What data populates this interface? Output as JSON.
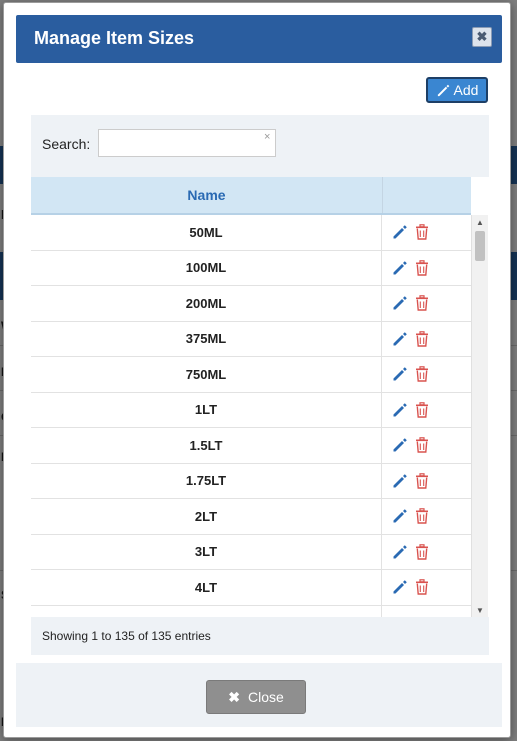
{
  "modal": {
    "title": "Manage Item Sizes",
    "header_close_glyph": "✖",
    "add_label": "Add",
    "search_label": "Search:",
    "search_value": "",
    "search_clear_glyph": "×",
    "column_name": "Name",
    "rows": [
      "50ML",
      "100ML",
      "200ML",
      "375ML",
      "750ML",
      "1LT",
      "1.5LT",
      "1.75LT",
      "2LT",
      "3LT",
      "4LT",
      ""
    ],
    "info": "Showing 1 to 135 of 135 entries",
    "close_label": "Close",
    "close_glyph": "✖"
  },
  "background_letters": [
    "h",
    "W",
    "IG",
    "G",
    "D",
    "S",
    "R"
  ],
  "colors": {
    "header_bg": "#2a5d9f",
    "add_button": "#3a86d1",
    "table_head_bg": "#d2e6f4",
    "name_header_text": "#2a6ab3",
    "edit_icon": "#2a6ab3",
    "delete_icon": "#d9534f",
    "close_button": "#8f8f8f"
  },
  "icons": {
    "edit": "pencil-icon",
    "delete": "trash-icon",
    "add": "pencil-icon",
    "close": "close-icon"
  }
}
